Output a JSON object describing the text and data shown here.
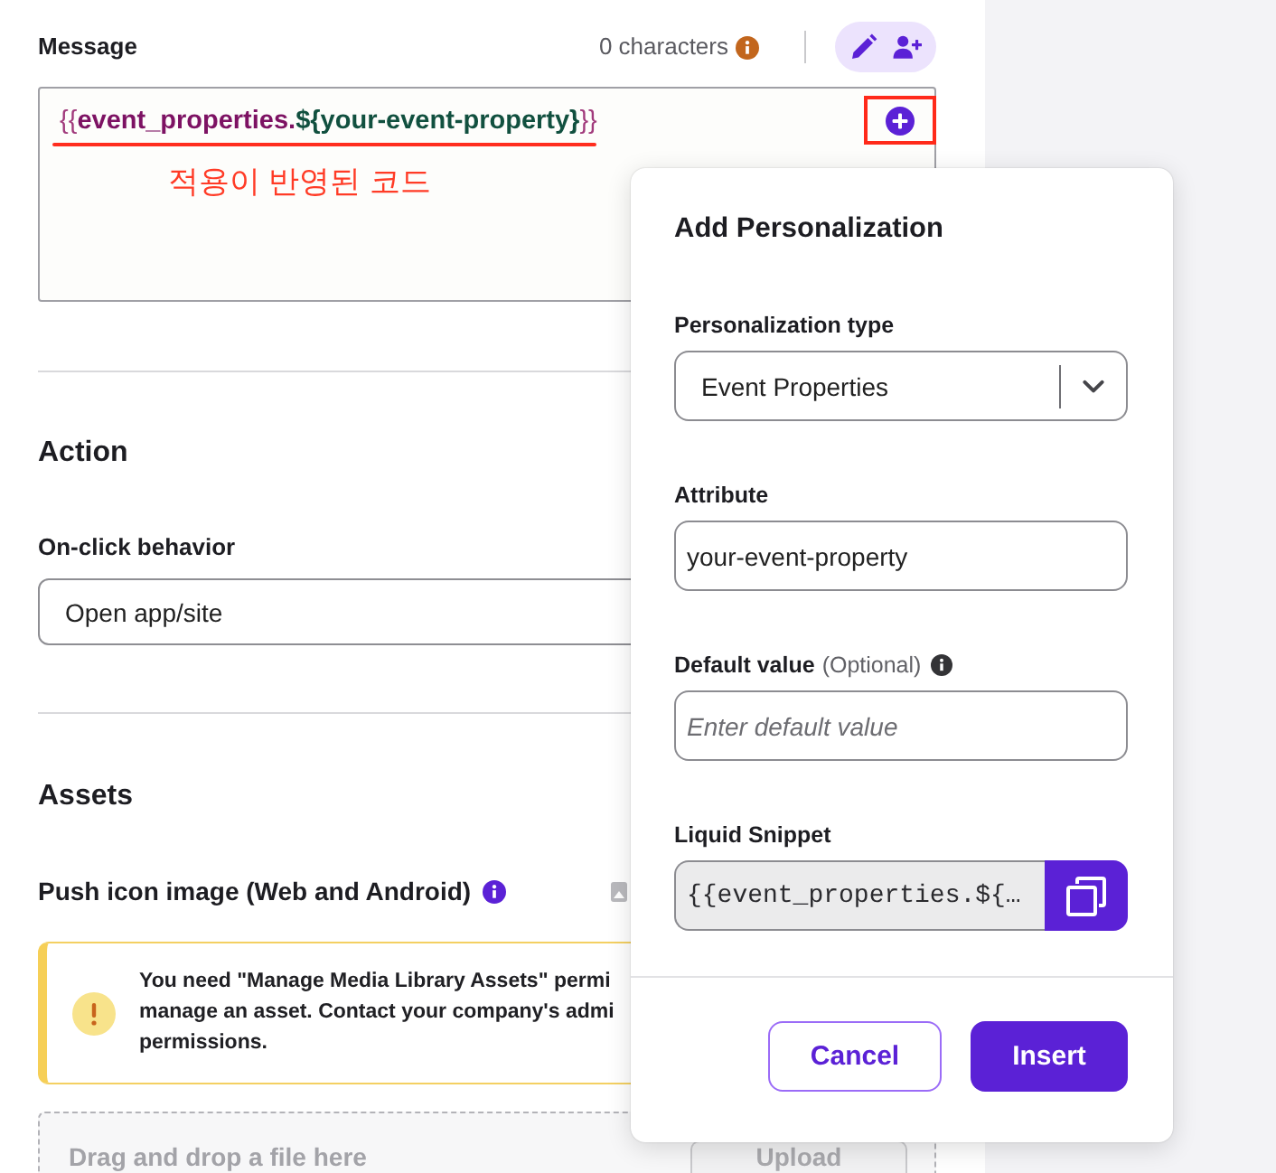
{
  "message": {
    "label": "Message",
    "counter": "0 characters",
    "toolbar_active": true,
    "tokens": [
      {
        "text": "{{",
        "kind": "brace"
      },
      {
        "text": "event_properties.",
        "kind": "object"
      },
      {
        "text": "${your-event-property}",
        "kind": "variable"
      },
      {
        "text": "}}",
        "kind": "brace"
      }
    ],
    "annotation": "적용이 반영된 코드"
  },
  "action": {
    "heading": "Action",
    "on_click": {
      "label": "On-click behavior",
      "value": "Open app/site"
    }
  },
  "assets": {
    "heading": "Assets",
    "push_icon": {
      "label": "Push icon image (Web and Android)",
      "info": true
    },
    "warning": {
      "lines": [
        "You need \"Manage Media Library Assets\" permi",
        "manage an asset. Contact your company's admi",
        "permissions."
      ]
    },
    "dropzone": {
      "text": "Drag and drop a file here",
      "upload": {
        "label": "Upload",
        "disabled": true
      }
    }
  },
  "popup": {
    "title": "Add Personalization",
    "fields": [
      {
        "kind": "select",
        "label": "Personalization type",
        "value": "Event Properties"
      },
      {
        "kind": "text",
        "label": "Attribute",
        "value": "your-event-property"
      },
      {
        "kind": "text",
        "label": "Default value",
        "note": "(Optional)",
        "info": true,
        "placeholder": "Enter default value"
      },
      {
        "kind": "snippet",
        "label": "Liquid Snippet",
        "value": "{{event_properties.${…"
      }
    ],
    "buttons": [
      {
        "label": "Cancel",
        "kind": "cancel"
      },
      {
        "label": "Insert",
        "kind": "confirm"
      }
    ]
  }
}
